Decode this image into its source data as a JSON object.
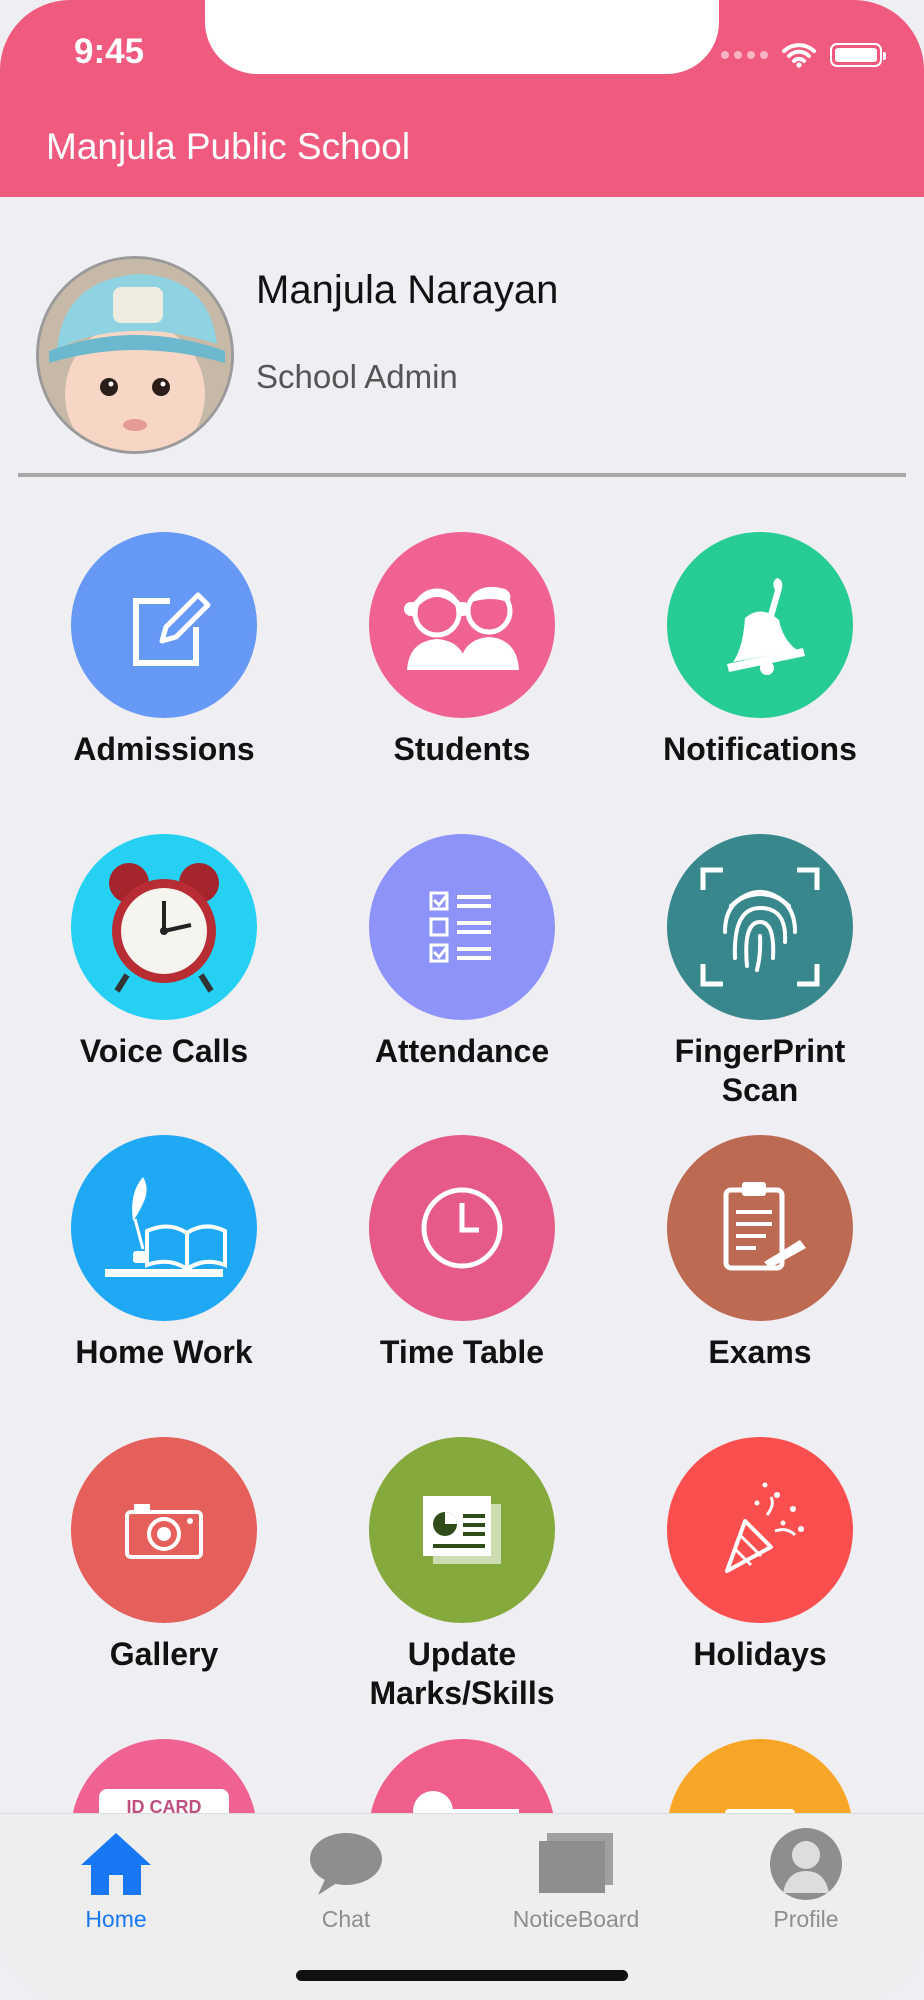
{
  "status_bar": {
    "time": "9:45"
  },
  "header": {
    "title": "Manjula Public School"
  },
  "profile": {
    "name": "Manjula Narayan",
    "role": "School Admin"
  },
  "grid": [
    {
      "label": "Admissions",
      "icon": "edit-icon",
      "color": "#6699f5"
    },
    {
      "label": "Students",
      "icon": "students-icon",
      "color": "#f06292"
    },
    {
      "label": "Notifications",
      "icon": "bell-icon",
      "color": "#27cc94"
    },
    {
      "label": "Voice Calls",
      "icon": "alarm-clock-icon",
      "color": "#25d0f3"
    },
    {
      "label": "Attendance",
      "icon": "checklist-icon",
      "color": "#8d93f8"
    },
    {
      "label": "FingerPrint\nScan",
      "icon": "fingerprint-icon",
      "color": "#37878c"
    },
    {
      "label": "Home Work",
      "icon": "book-quill-icon",
      "color": "#1fa8f4"
    },
    {
      "label": "Time Table",
      "icon": "clock-icon",
      "color": "#e55a87"
    },
    {
      "label": "Exams",
      "icon": "clipboard-icon",
      "color": "#bd6a52"
    },
    {
      "label": "Gallery",
      "icon": "camera-icon",
      "color": "#e55f5b"
    },
    {
      "label": "Update\nMarks/Skills",
      "icon": "report-icon",
      "color": "#86a93e"
    },
    {
      "label": "Holidays",
      "icon": "party-popper-icon",
      "color": "#fb4f4f"
    },
    {
      "label": "ID CARD",
      "icon": "id-card-icon",
      "color": "#f06292"
    },
    {
      "label": "",
      "icon": "toggle-icon",
      "color": "#f05f8c"
    },
    {
      "label": "",
      "icon": "ticket-icon",
      "color": "#f8a628"
    }
  ],
  "tabbar": {
    "home": "Home",
    "chat": "Chat",
    "noticeboard": "NoticeBoard",
    "profile": "Profile",
    "active_color": "#1877f2",
    "inactive_color": "#8e8e8e"
  },
  "colors": {
    "brand": "#f05a7e",
    "background": "#efeef3"
  }
}
